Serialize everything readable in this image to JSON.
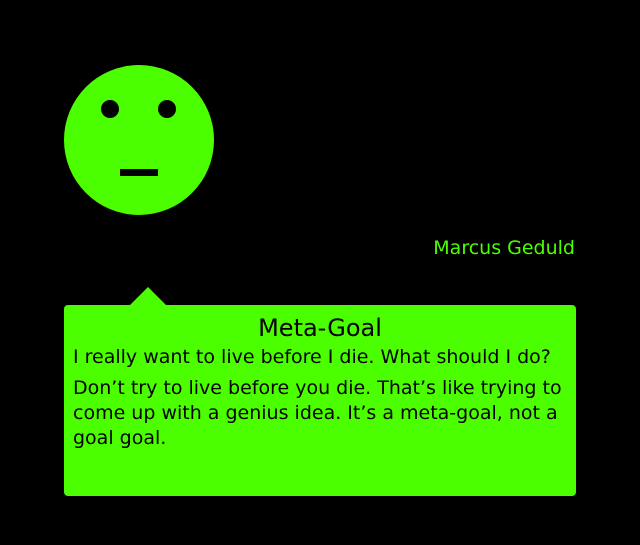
{
  "author": "Marcus Geduld",
  "bubble": {
    "title": "Meta-Goal",
    "question": "I really want to live before I die. What should I do?",
    "answer": "Don’t try to live before you die. That’s like trying to come up with a genius idea. It’s a meta-goal, not a goal goal."
  },
  "colors": {
    "background": "#000000",
    "accent": "#4cff00"
  },
  "icons": {
    "avatar": "neutral-face-icon"
  }
}
